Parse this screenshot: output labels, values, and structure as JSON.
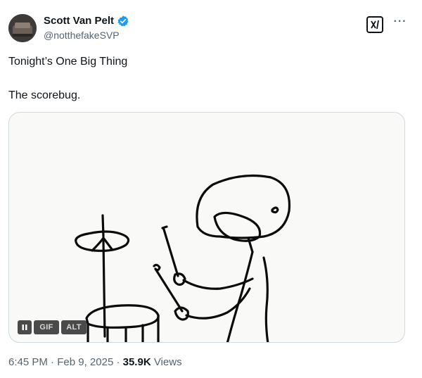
{
  "author": {
    "display_name": "Scott Van Pelt",
    "handle": "@notthefakeSVP",
    "verified_color": "#1d9bf0"
  },
  "header_actions": {
    "grok_icon": "grok-icon",
    "more_label": "···"
  },
  "tweet": {
    "line1": "Tonight’s One Big Thing",
    "line2": "The scorebug."
  },
  "media": {
    "type": "gif",
    "description_icon": "stick-figure-drummer",
    "controls": {
      "pause_icon": "pause-icon",
      "gif_label": "GIF",
      "alt_label": "ALT"
    }
  },
  "meta": {
    "time": "6:45 PM",
    "separator1": "·",
    "date": "Feb 9, 2025",
    "separator2": "·",
    "views_count": "35.9K",
    "views_label": "Views"
  }
}
